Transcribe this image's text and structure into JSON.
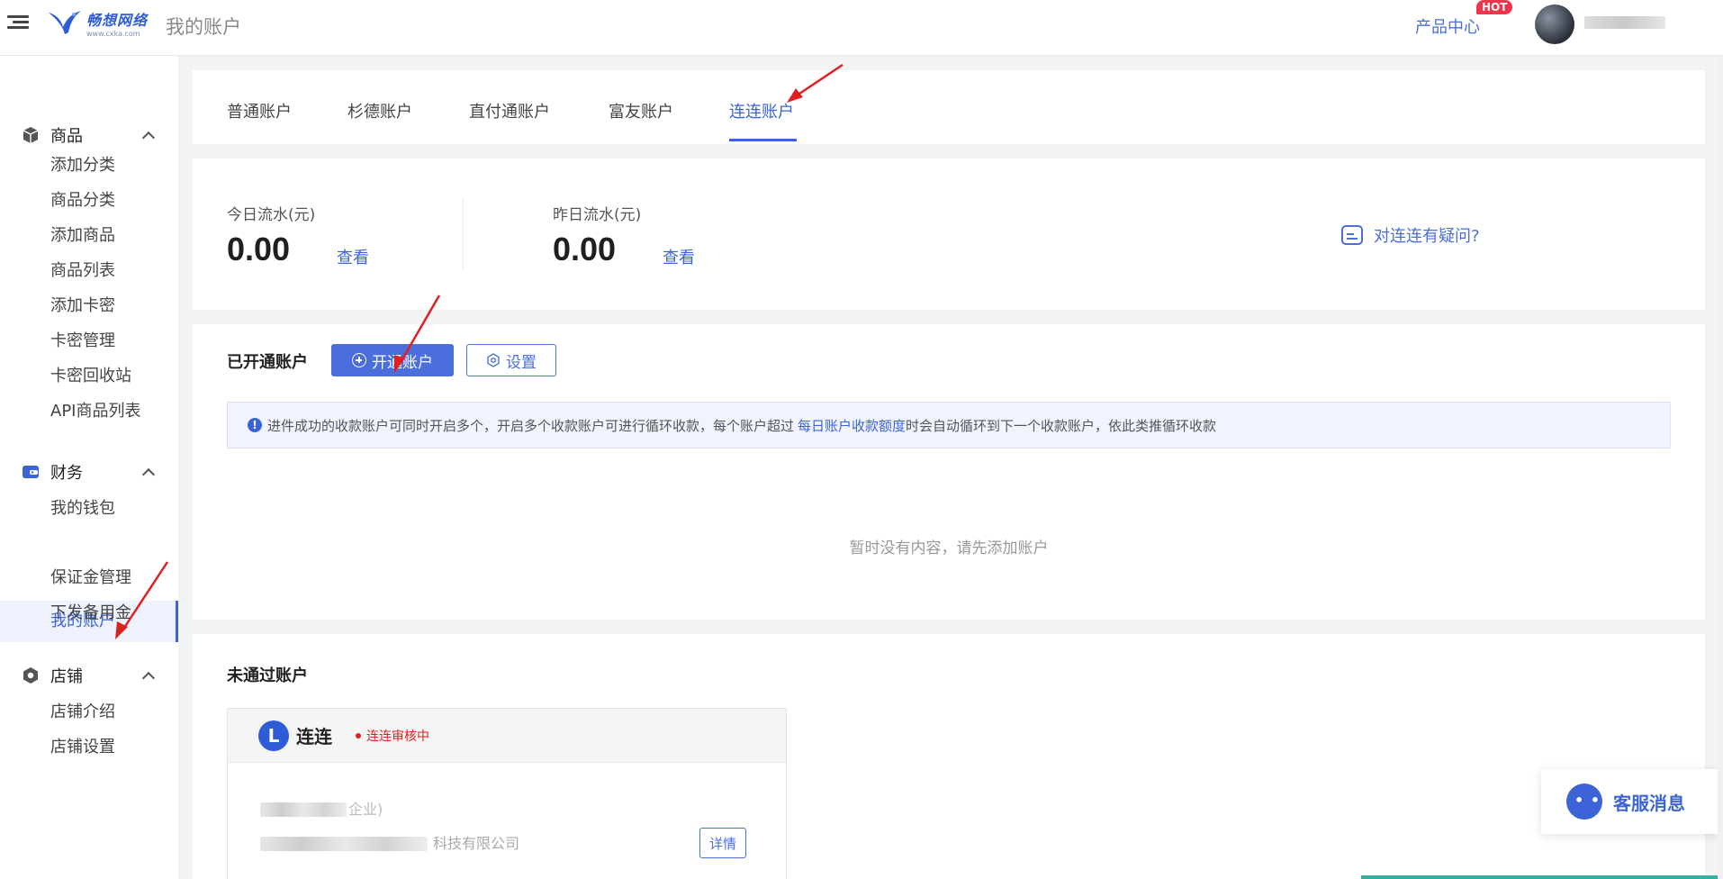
{
  "header": {
    "logo_name": "畅想网络",
    "logo_url": "www.cxka.com",
    "page_title": "我的账户",
    "product_center": "产品中心",
    "hot_badge": "HOT"
  },
  "sidebar": {
    "groups": [
      {
        "label": "商品",
        "icon": "cube-icon",
        "items": [
          "添加分类",
          "商品分类",
          "添加商品",
          "商品列表",
          "添加卡密",
          "卡密管理",
          "卡密回收站",
          "API商品列表"
        ]
      },
      {
        "label": "财务",
        "icon": "wallet-icon",
        "items": [
          "我的钱包",
          "我的账户",
          "保证金管理",
          "下发备用金"
        ]
      },
      {
        "label": "店铺",
        "icon": "store-icon",
        "items": [
          "店铺介绍",
          "店铺设置"
        ]
      }
    ],
    "active_item": "我的账户"
  },
  "tabs": {
    "items": [
      "普通账户",
      "杉德账户",
      "直付通账户",
      "富友账户",
      "连连账户"
    ],
    "active": "连连账户"
  },
  "flow": {
    "today_label": "今日流水(元)",
    "today_value": "0.00",
    "today_link": "查看",
    "yesterday_label": "昨日流水(元)",
    "yesterday_value": "0.00",
    "yesterday_link": "查看",
    "faq": "对连连有疑问?"
  },
  "opened": {
    "title": "已开通账户",
    "open_button": "开通账户",
    "settings_button": "设置",
    "notice_text": "进件成功的收款账户可同时开启多个，开启多个收款账户可进行循环收款，每个账户超过",
    "notice_link": "每日账户收款额度",
    "notice_text_after": "时会自动循环到下一个收款账户，依此类推循环收款",
    "empty_text": "暂时没有内容，请先添加账户"
  },
  "failed": {
    "title": "未通过账户",
    "card": {
      "logo_letter": "L",
      "name": "连连",
      "status": "连连审核中",
      "line1_tail": "企业)",
      "line2_tail": "科技有限公司",
      "detail_button": "详情"
    }
  },
  "service": {
    "label": "客服消息"
  },
  "colors": {
    "primary": "#3c64d6",
    "danger": "#e02020",
    "hot": "#f0344a"
  }
}
